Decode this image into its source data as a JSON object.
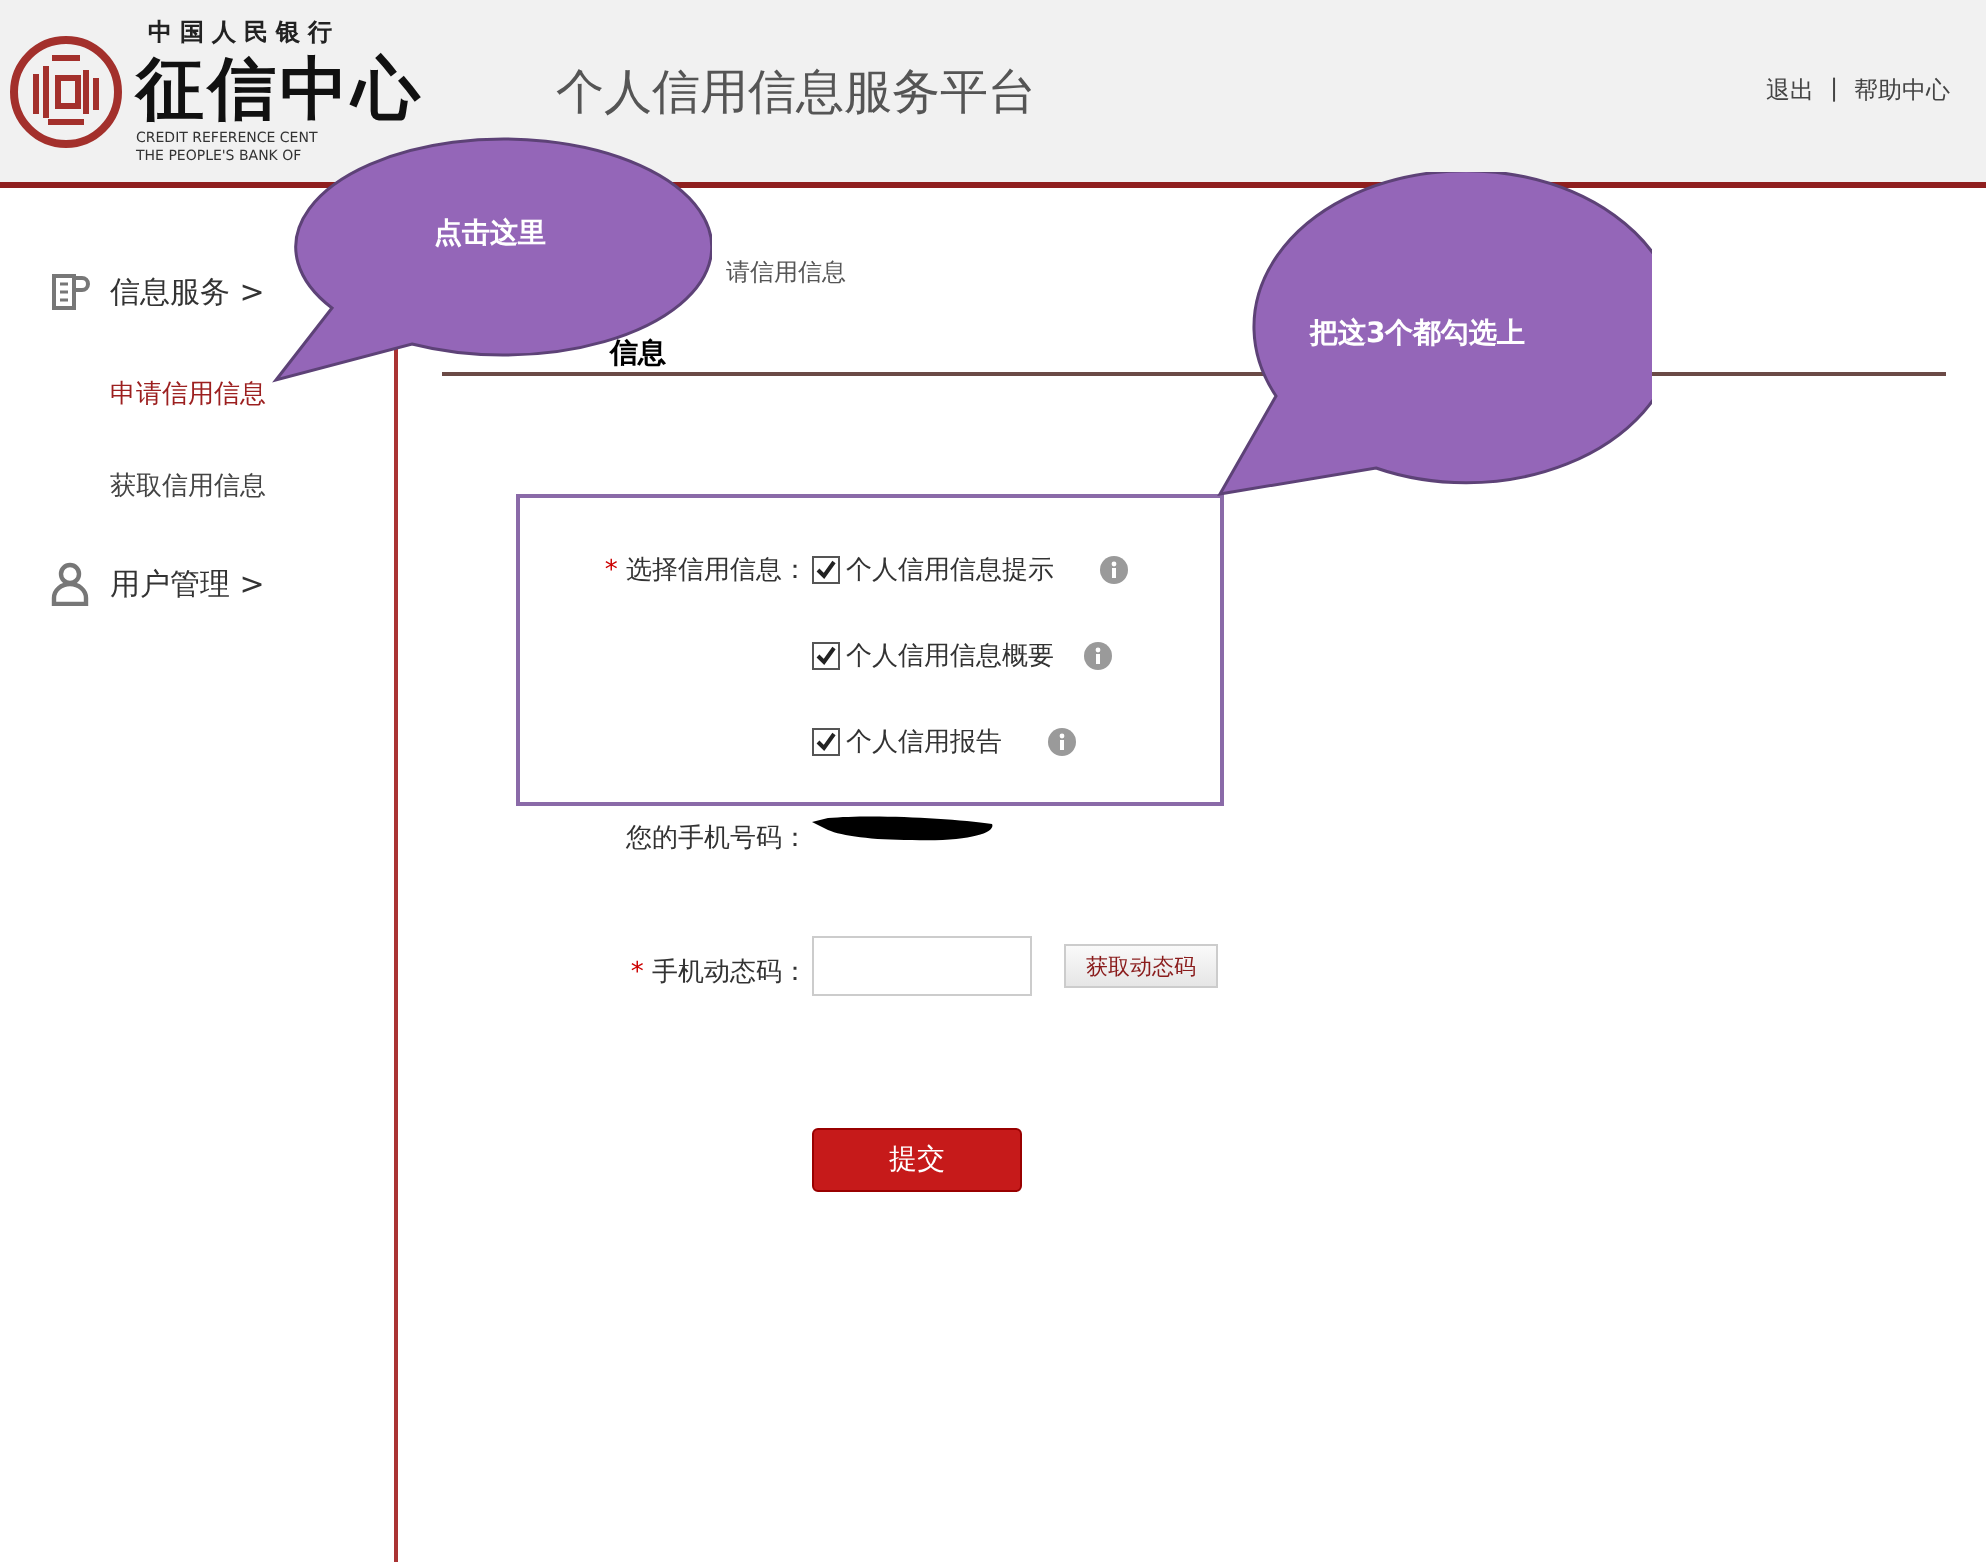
{
  "header": {
    "logo_top": "中国人民银行",
    "logo_name": "征信中心",
    "logo_en_1": "CREDIT REFERENCE CENT",
    "logo_en_2": "THE PEOPLE'S BANK OF",
    "platform_title": "个人信用信息服务平台",
    "links": [
      "退出",
      "帮助中心"
    ],
    "separator": "|"
  },
  "sidebar": {
    "groups": [
      {
        "kind": "document",
        "label": "信息服务 >",
        "items": [
          {
            "label": "申请信用信息",
            "selected": true
          },
          {
            "label": "获取信用信息",
            "selected": false
          }
        ]
      },
      {
        "kind": "user",
        "label": "用户管理 >"
      }
    ]
  },
  "breadcrumb": "请信用信息",
  "section_title": "信息",
  "form": {
    "select_label": "选择信用信息：",
    "required_mark": "*",
    "options": [
      {
        "label": "个人信用信息提示",
        "checked": true
      },
      {
        "label": "个人信用信息概要",
        "checked": true
      },
      {
        "label": "个人信用报告",
        "checked": true
      }
    ],
    "phone_label": "您的手机号码：",
    "code_label": "手机动态码：",
    "code_button": "获取动态码",
    "submit": "提交"
  },
  "annotations": [
    {
      "kind": "left",
      "text": "点击这里"
    },
    {
      "kind": "right",
      "text": "把这3个都勾选上"
    }
  ]
}
